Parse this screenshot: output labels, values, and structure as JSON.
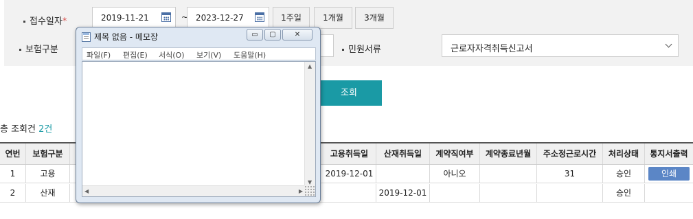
{
  "search": {
    "receipt_date_label": "접수일자",
    "required_mark": "*",
    "date_from": "2019-11-21",
    "date_separator": "~",
    "date_to": "2023-12-27",
    "period_buttons": [
      "1주일",
      "1개월",
      "3개월"
    ],
    "insurance_type_label": "보험구분",
    "civil_doc_label": "민원서류",
    "civil_doc_value": "근로자자격취득신고서",
    "search_button": "조회"
  },
  "results": {
    "total_label": "총 조회건",
    "total_count": "2건"
  },
  "table": {
    "columns": [
      "연번",
      "보험구분",
      "고용취득일",
      "산재취득일",
      "계약직여부",
      "계약종료년월",
      "주소정근로시간",
      "처리상태",
      "통지서출력"
    ],
    "rows": [
      {
        "no": "1",
        "insurance": "고용",
        "emp_date": "2019-12-01",
        "ind_date": "",
        "contract": "아니오",
        "contract_end": "",
        "hours": "31",
        "status": "승인",
        "print": "인쇄"
      },
      {
        "no": "2",
        "insurance": "산재",
        "emp_date": "",
        "ind_date": "2019-12-01",
        "contract": "",
        "contract_end": "",
        "hours": "",
        "status": "승인",
        "print": ""
      }
    ]
  },
  "notepad": {
    "title": "제목 없음 - 메모장",
    "menu": [
      "파일(F)",
      "편집(E)",
      "서식(O)",
      "보기(V)",
      "도움말(H)"
    ],
    "controls": {
      "minimize": "▭",
      "maximize": "▢",
      "close": "✕"
    }
  },
  "colors": {
    "accent": "#1a9aa5",
    "print_button": "#5b86c6",
    "required": "#d9534f"
  }
}
